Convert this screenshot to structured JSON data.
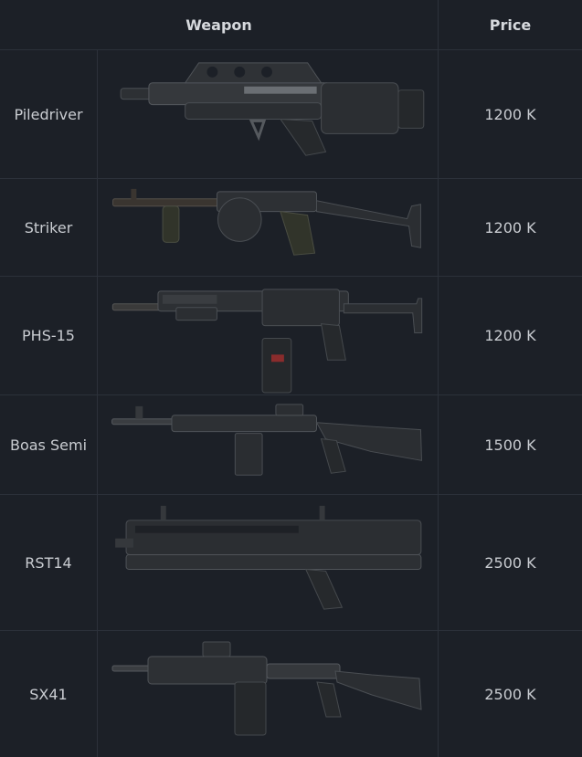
{
  "table": {
    "headers": {
      "weapon": "Weapon",
      "price": "Price"
    },
    "rows": [
      {
        "name": "Piledriver",
        "price": "1200 K",
        "icon": "piledriver-shotgun-image"
      },
      {
        "name": "Striker",
        "price": "1200 K",
        "icon": "striker-shotgun-image"
      },
      {
        "name": "PHS-15",
        "price": "1200 K",
        "icon": "phs15-shotgun-image"
      },
      {
        "name": "Boas Semi",
        "price": "1500 K",
        "icon": "boas-semi-shotgun-image"
      },
      {
        "name": "RST14",
        "price": "2500 K",
        "icon": "rst14-shotgun-image"
      },
      {
        "name": "SX41",
        "price": "2500 K",
        "icon": "sx41-shotgun-image"
      }
    ]
  },
  "colors": {
    "background": "#1c2027",
    "divider": "#2c313a",
    "text": "#c9ccd1",
    "metal": "#3a3d41"
  }
}
